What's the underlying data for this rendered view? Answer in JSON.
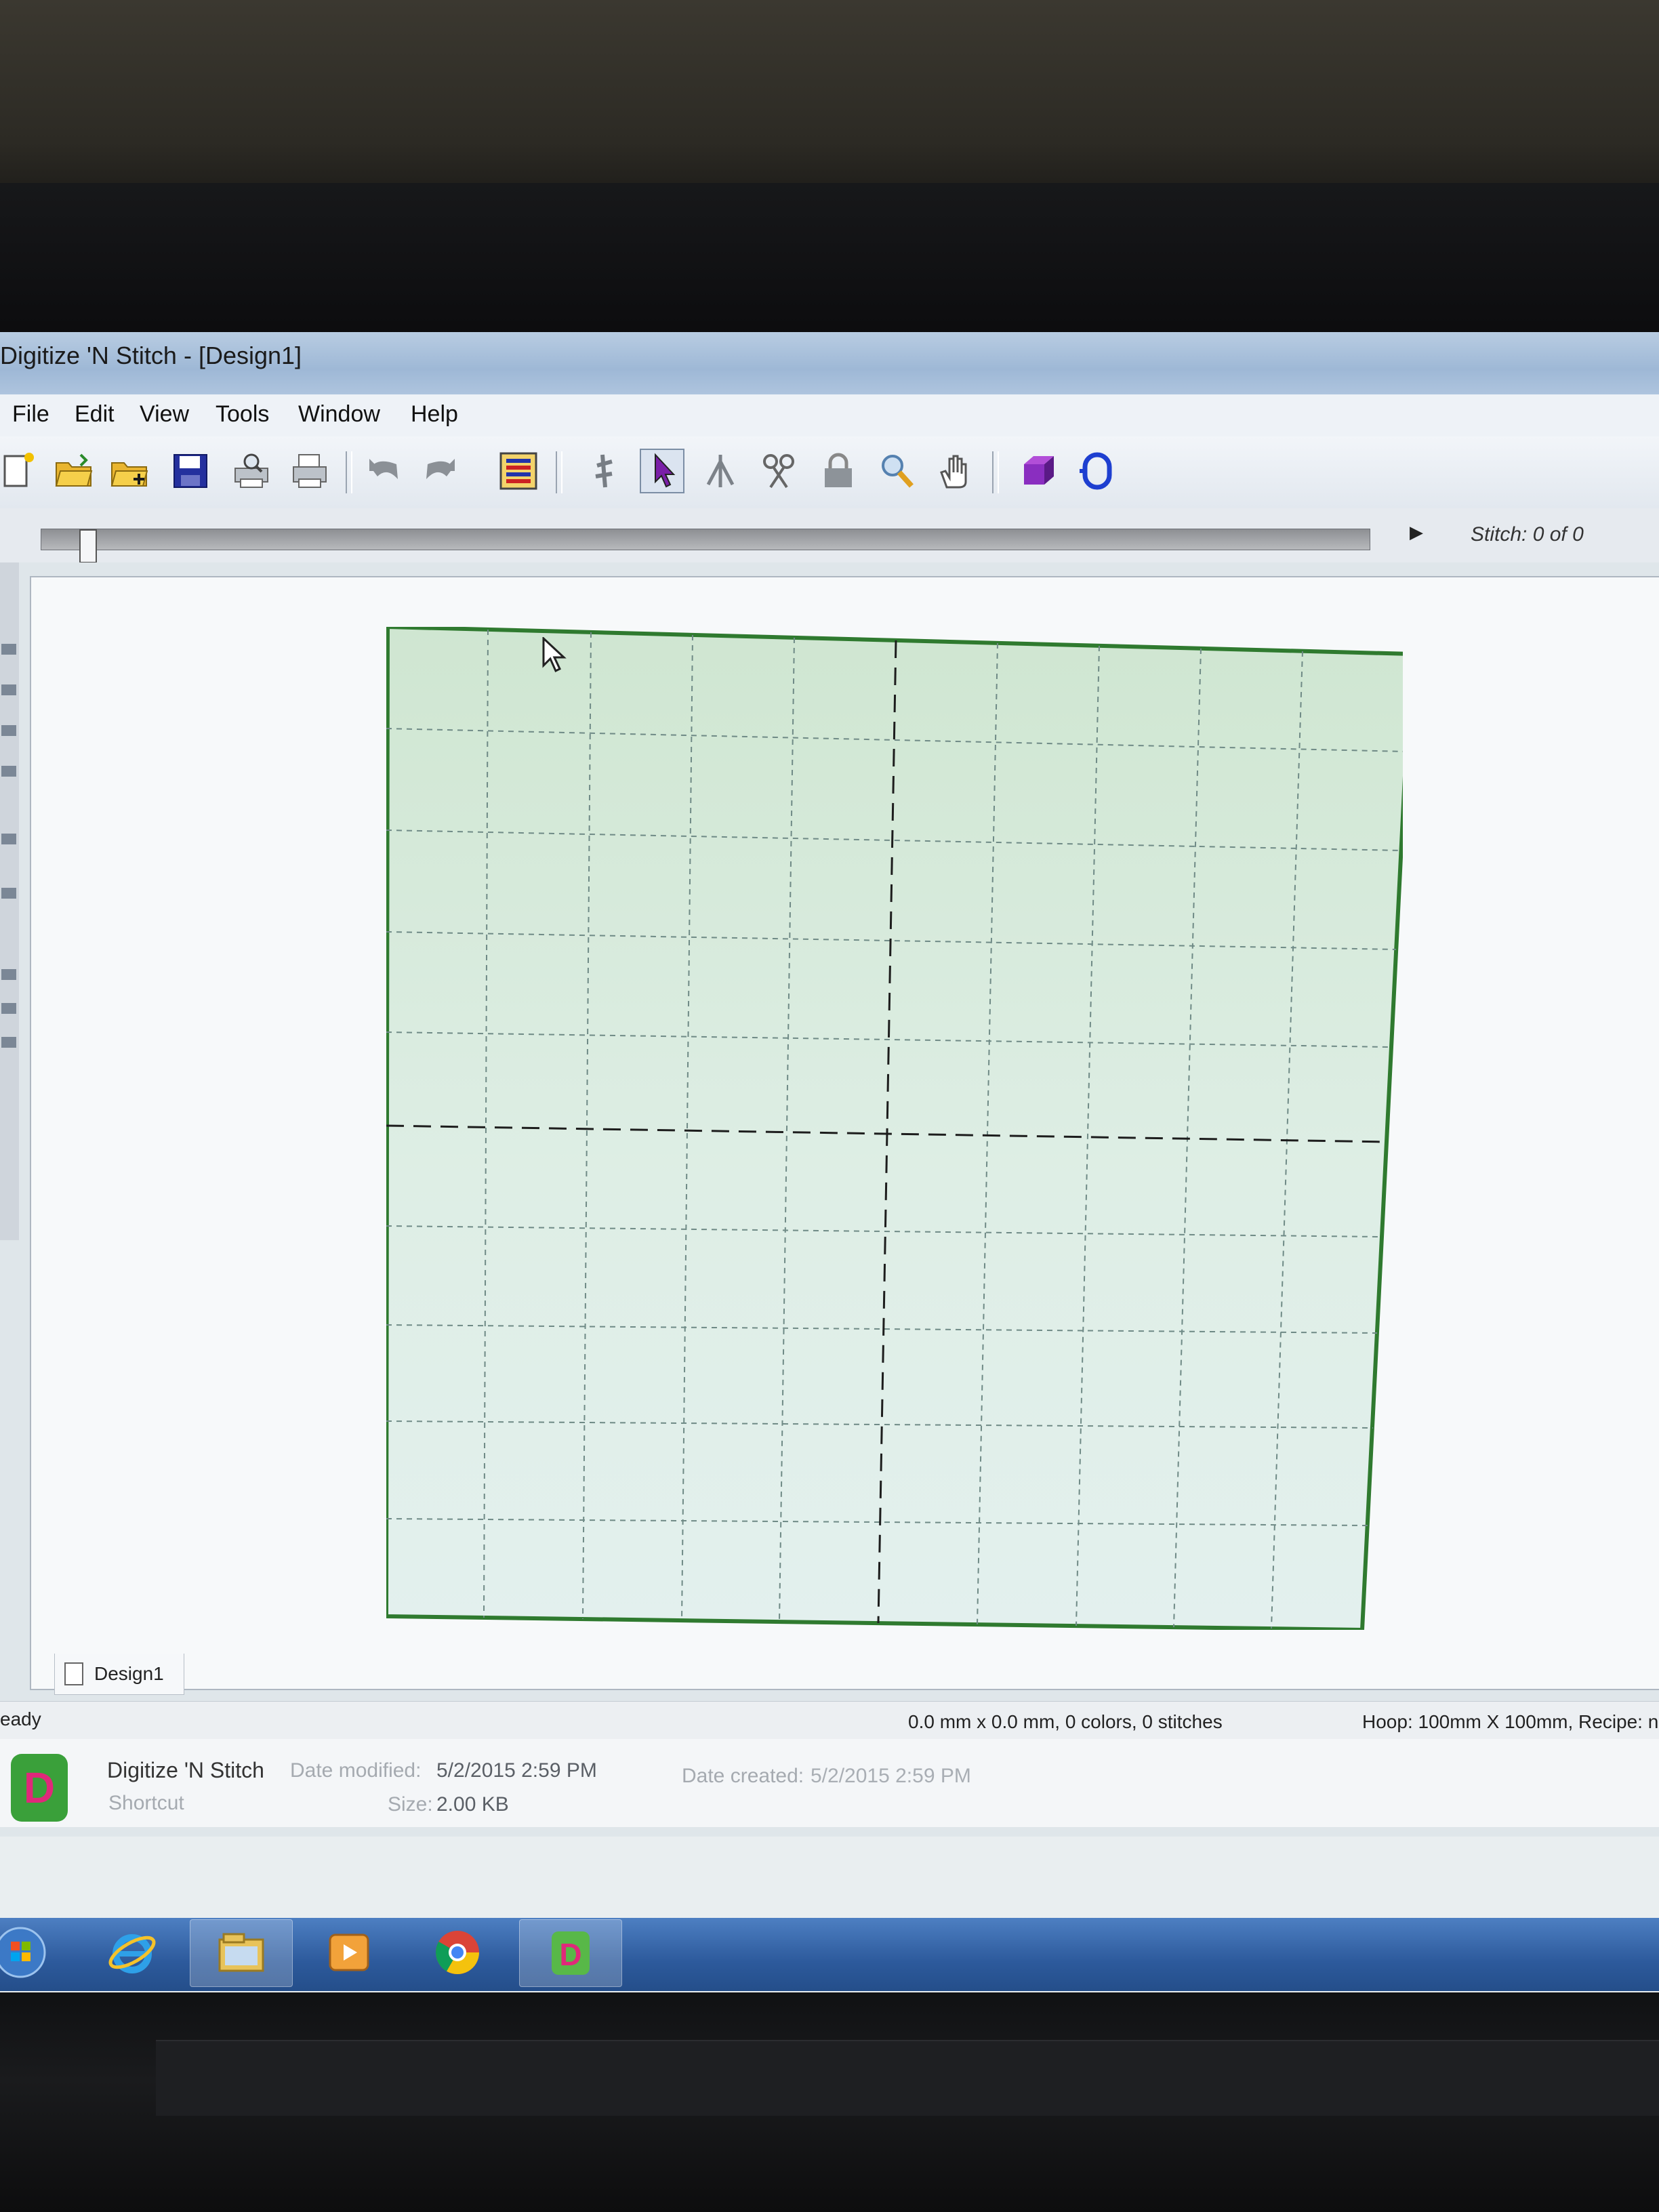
{
  "window": {
    "title": "Digitize 'N Stitch - [Design1]"
  },
  "menu": {
    "items": [
      "File",
      "Edit",
      "View",
      "Tools",
      "Window",
      "Help"
    ]
  },
  "toolbar": {
    "icons": [
      "new-icon",
      "open-icon",
      "open-add-icon",
      "save-icon",
      "print-preview-icon",
      "print-icon",
      "undo-icon",
      "redo-icon",
      "color-list-icon",
      "stitch-tool-icon",
      "select-arrow-icon",
      "transform-icon",
      "cut-icon",
      "lock-icon",
      "zoom-icon",
      "pan-hand-icon",
      "3d-view-icon",
      "hoop-icon"
    ]
  },
  "stitch": {
    "label": "Stitch:  0 of 0",
    "position": 0
  },
  "document": {
    "tab_label": "Design1"
  },
  "status": {
    "ready": "eady",
    "size": "0.0 mm x 0.0 mm, 0 colors, 0 stitches",
    "hoop": "Hoop: 100mm X 100mm, Recipe: n"
  },
  "details": {
    "name": "Digitize 'N Stitch",
    "type": "Shortcut",
    "date_modified_label": "Date modified:",
    "date_modified": "5/2/2015 2:59 PM",
    "size_label": "Size:",
    "size": "2.00 KB",
    "date_created_label": "Date created:",
    "date_created": "5/2/2015 2:59 PM",
    "icon_letter": "D"
  },
  "taskbar": {
    "items": [
      "start-button",
      "internet-explorer-icon",
      "file-explorer-icon",
      "media-player-icon",
      "chrome-icon",
      "digitize-n-stitch-icon"
    ],
    "app_letter": "D"
  },
  "colors": {
    "hoop_border": "#2f7a2f",
    "hoop_fill": "#d6ead9",
    "titlebar": "#a9c0dc",
    "taskbar": "#2d5a9c"
  }
}
